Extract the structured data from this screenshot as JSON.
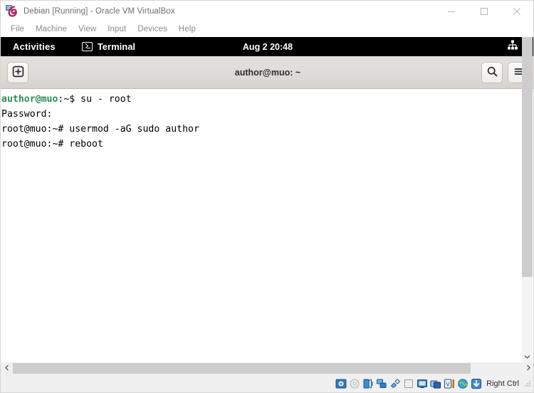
{
  "window": {
    "title": "Debian [Running] - Oracle VM VirtualBox",
    "logo_icon": "virtualbox-logo-icon",
    "controls": {
      "minimize": "minimize-icon",
      "maximize": "maximize-icon",
      "close": "close-icon"
    },
    "menu": [
      {
        "label": "File"
      },
      {
        "label": "Machine"
      },
      {
        "label": "View"
      },
      {
        "label": "Input"
      },
      {
        "label": "Devices"
      },
      {
        "label": "Help"
      }
    ]
  },
  "gnome_panel": {
    "activities": "Activities",
    "app_icon": "terminal-icon",
    "app_name": "Terminal",
    "clock": "Aug 2  20:48",
    "network_icon": "network-workgroup-icon",
    "system_menu_icon": "chevron-down-icon"
  },
  "terminal": {
    "new_tab_icon": "plus-square-icon",
    "title": "author@muo: ~",
    "search_icon": "search-icon",
    "menu_icon": "hamburger-menu-icon",
    "lines": [
      {
        "prompt_user": "author@muo",
        "prompt_rest": ":~$ ",
        "command": "su - root",
        "prompt_color": "#2e8b57"
      },
      {
        "prompt_user": "",
        "prompt_rest": "",
        "command": "Password:",
        "prompt_color": "#000000"
      },
      {
        "prompt_user": "",
        "prompt_rest": "root@muo:~# ",
        "command": "usermod -aG sudo author",
        "prompt_color": "#000000"
      },
      {
        "prompt_user": "",
        "prompt_rest": "root@muo:~# ",
        "command": "reboot",
        "prompt_color": "#000000"
      }
    ]
  },
  "scrollbars": {
    "horizontal_left_arrow": "chevron-left-icon",
    "horizontal_right_arrow": "chevron-right-icon",
    "vertical_down_arrow": "chevron-down-icon"
  },
  "statusbar": {
    "icons": [
      {
        "name": "hard-disk-icon"
      },
      {
        "name": "optical-disk-icon"
      },
      {
        "name": "audio-icon"
      },
      {
        "name": "network-icon"
      },
      {
        "name": "usb-icon"
      },
      {
        "name": "shared-clipboard-icon"
      },
      {
        "name": "display-icon"
      },
      {
        "name": "shared-folders-icon"
      },
      {
        "name": "video-capture-icon"
      },
      {
        "name": "mouse-integration-icon"
      },
      {
        "name": "host-key-icon"
      }
    ],
    "host_key_label": "Right Ctrl"
  },
  "colors": {
    "panel_black": "#000000",
    "headerbar": "#dedbd7",
    "terminal_bg": "#ffffff",
    "prompt_green": "#2e8b57",
    "scroll_thumb": "#cdcdcd"
  }
}
